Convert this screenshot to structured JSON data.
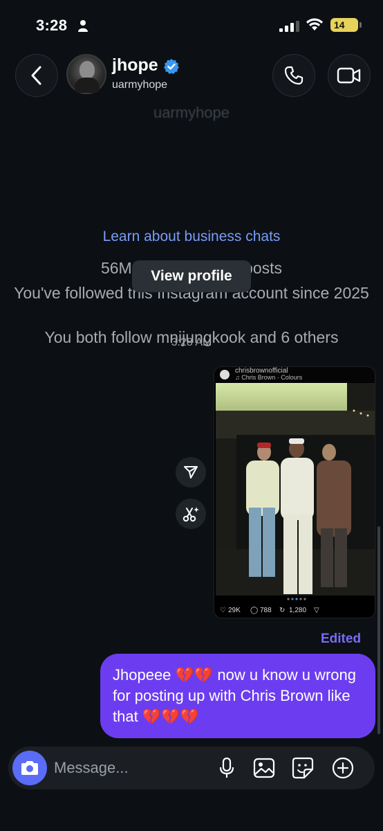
{
  "status_bar": {
    "time": "3:28",
    "battery": "14"
  },
  "header": {
    "name": "jhope",
    "username": "uarmyhope"
  },
  "profile": {
    "username_large": "uarmyhope",
    "followers_line": "56M followers · 355 posts",
    "followed_since": "You've followed this Instagram account since 2025",
    "mutuals": "You both follow mnijungkook and 6 others",
    "learn_link": "Learn about business chats",
    "view_profile_label": "View profile"
  },
  "thread": {
    "timestamp": "3:28 AM",
    "shared_post": {
      "account": "chrisbrownofficial",
      "audio": "♫ Chris Brown · Colours",
      "likes": "29K",
      "comments": "788",
      "reposts": "1,280"
    },
    "edited_label": "Edited",
    "message": "Jhopeee 💔💔 now u know u wrong for posting up with Chris Brown like that 💔💔💔"
  },
  "composer": {
    "placeholder": "Message..."
  },
  "colors": {
    "background": "#0c1014",
    "bubble": "#6c3df0",
    "link": "#7a9cf7",
    "camera_button": "#5b6cf6",
    "verified": "#3897f0"
  }
}
